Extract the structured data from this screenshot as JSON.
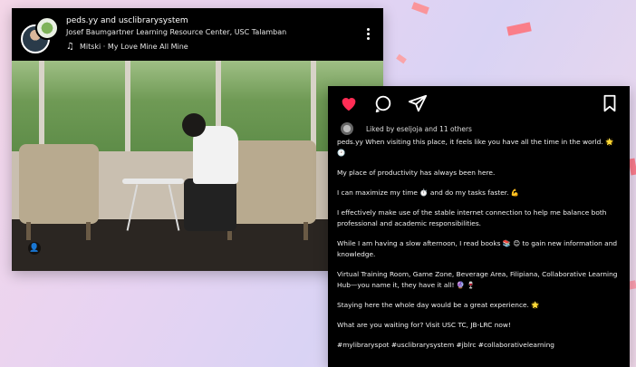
{
  "post": {
    "header": {
      "accounts": "peds.yy and usclibrarysystem",
      "location": "Josef Baumgartner Learning Resource Center, USC Talamban",
      "music": "Mitski · My Love Mine All Mine"
    },
    "icons": {
      "music": "music-note-icon",
      "more": "more-vertical-icon",
      "tag": "user-tag-icon"
    }
  },
  "caption": {
    "icons": {
      "like": "heart-icon",
      "comment": "comment-icon",
      "share": "send-icon",
      "save": "bookmark-icon"
    },
    "colors": {
      "like": "#ff2d55"
    },
    "likes_text": "Liked by eseljoja and 11 others",
    "paragraphs": [
      "peds.yy When visiting this place, it feels like you have all the time in the world. 🌟 🕑",
      "My place of productivity has always been here.",
      "I can maximize my time ⏱️ and do my tasks faster. 💪",
      "I effectively make use of the stable internet connection to help me balance both professional and academic responsibilities.",
      "While I am having a slow afternoon, I read books 📚 😊 to gain new information and knowledge.",
      "Virtual Training Room, Game Zone, Beverage Area, Filipiana, Collaborative Learning Hub—you name it, they have it all! 🔮 🍷",
      "Staying here the whole day would be a great experience. 🌟",
      "What are you waiting for? Visit USC TC, JB-LRC now!",
      "#mylibraryspot #usclibrarysystem #jblrc #collaborativelearning"
    ]
  }
}
